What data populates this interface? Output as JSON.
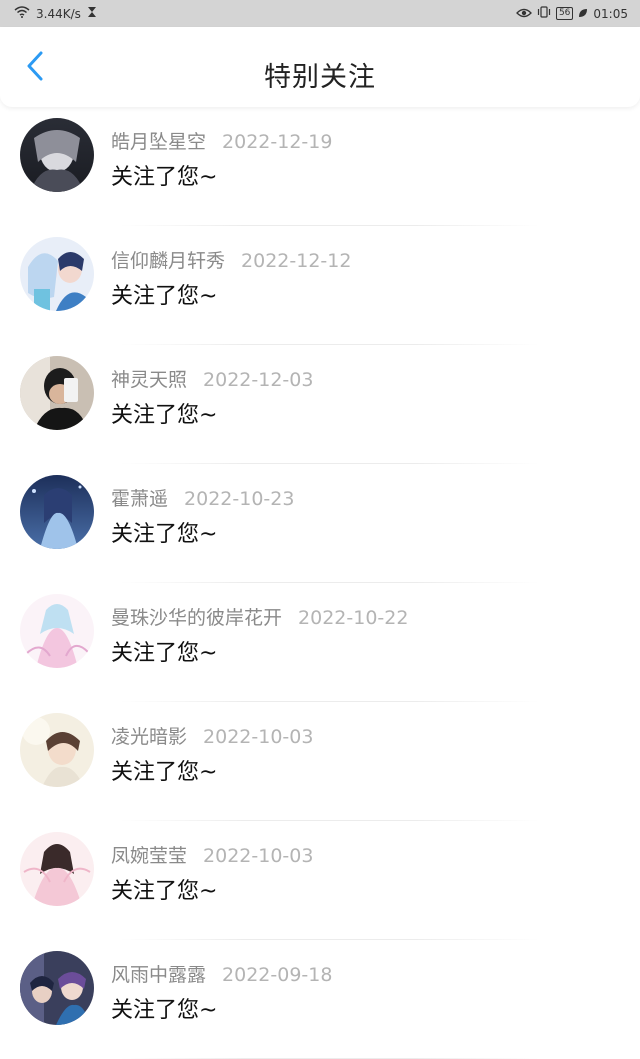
{
  "status_bar": {
    "speed": "3.44K/s",
    "battery": "56",
    "time": "01:05"
  },
  "header": {
    "title": "特别关注"
  },
  "items": [
    {
      "name": "皓月坠星空",
      "date": "2022-12-19",
      "message": "关注了您~"
    },
    {
      "name": "信仰麟月轩秀",
      "date": "2022-12-12",
      "message": "关注了您~"
    },
    {
      "name": "神灵天照",
      "date": "2022-12-03",
      "message": "关注了您~"
    },
    {
      "name": "霍萧遥",
      "date": "2022-10-23",
      "message": "关注了您~"
    },
    {
      "name": "曼珠沙华的彼岸花开",
      "date": "2022-10-22",
      "message": "关注了您~"
    },
    {
      "name": "凌光暗影",
      "date": "2022-10-03",
      "message": "关注了您~"
    },
    {
      "name": "凤婉莹莹",
      "date": "2022-10-03",
      "message": "关注了您~"
    },
    {
      "name": "风雨中露露",
      "date": "2022-09-18",
      "message": "关注了您~"
    }
  ],
  "colors": {
    "accent": "#2b9af3",
    "status_bar_bg": "#d4d4d4"
  }
}
